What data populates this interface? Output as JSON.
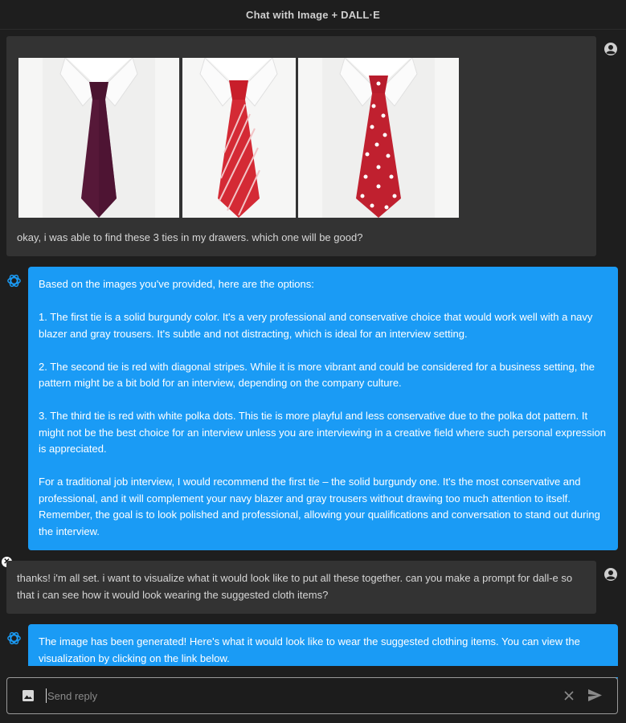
{
  "header": {
    "title": "Chat with Image + DALL·E"
  },
  "messages": {
    "user1": {
      "images": [
        {
          "alt": "solid burgundy tie",
          "icon": "tie-solid-burgundy"
        },
        {
          "alt": "red tie with diagonal stripes",
          "icon": "tie-striped-red"
        },
        {
          "alt": "red tie with white polka dots",
          "icon": "tie-polka-dot-red"
        }
      ],
      "text": "okay, i was able to find these 3 ties in my drawers. which one will be good?"
    },
    "bot1": {
      "paragraphs": [
        "Based on the images you've provided, here are the options:",
        "1. The first tie is a solid burgundy color. It's a very professional and conservative choice that would work well with a navy blazer and gray trousers. It's subtle and not distracting, which is ideal for an interview setting.",
        "2. The second tie is red with diagonal stripes. While it is more vibrant and could be considered for a business setting, the pattern might be a bit bold for an interview, depending on the company culture.",
        "3. The third tie is red with white polka dots. This tie is more playful and less conservative due to the polka dot pattern. It might not be the best choice for an interview unless you are interviewing in a creative field where such personal expression is appreciated.",
        "For a traditional job interview, I would recommend the first tie – the solid burgundy one. It's the most conservative and professional, and it will complement your navy blazer and gray trousers without drawing too much attention to itself. Remember, the goal is to look polished and professional, allowing your qualifications and conversation to stand out during the interview."
      ]
    },
    "user2": {
      "text": "thanks! i'm all set. i want to visualize what it would look like to put all these together. can you make a prompt for dall-e so that i can see how it would look wearing the suggested cloth items?"
    },
    "bot2": {
      "text": "The image has been generated! Here's what it would look like to wear the suggested clothing items. You can view the visualization by clicking on the link below."
    }
  },
  "input": {
    "placeholder": "Send reply",
    "value": ""
  },
  "colors": {
    "bot_bubble": "#1a9bf5",
    "user_bubble": "#333333",
    "background": "#1e1e1e"
  }
}
